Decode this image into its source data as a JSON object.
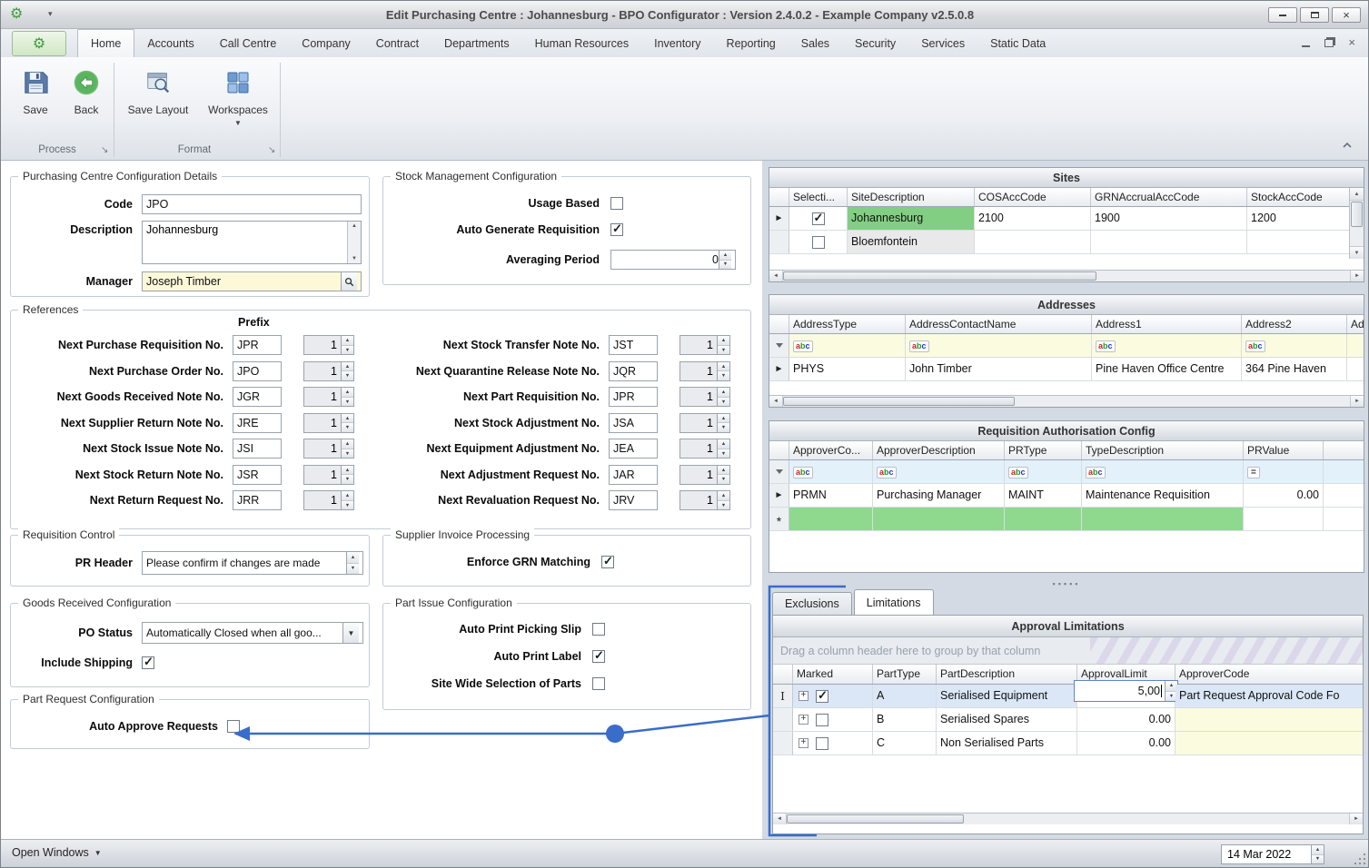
{
  "window": {
    "title": "Edit Purchasing Centre : Johannesburg - BPO Configurator : Version 2.4.0.2 - Example Company v2.5.0.8"
  },
  "ribbon": {
    "tabs": [
      {
        "label": "Home"
      },
      {
        "label": "Accounts"
      },
      {
        "label": "Call Centre"
      },
      {
        "label": "Company"
      },
      {
        "label": "Contract"
      },
      {
        "label": "Departments"
      },
      {
        "label": "Human Resources"
      },
      {
        "label": "Inventory"
      },
      {
        "label": "Reporting"
      },
      {
        "label": "Sales"
      },
      {
        "label": "Security"
      },
      {
        "label": "Services"
      },
      {
        "label": "Static Data"
      }
    ],
    "active_tab": "Home",
    "buttons": {
      "save": "Save",
      "back": "Back",
      "save_layout": "Save Layout",
      "workspaces": "Workspaces"
    },
    "groups": {
      "process": "Process",
      "format": "Format"
    }
  },
  "config_details": {
    "title": "Purchasing Centre Configuration Details",
    "code_label": "Code",
    "code_value": "JPO",
    "description_label": "Description",
    "description_value": "Johannesburg",
    "manager_label": "Manager",
    "manager_value": "Joseph Timber"
  },
  "stock_mgmt": {
    "title": "Stock Management Configuration",
    "usage_based_label": "Usage Based",
    "usage_based": false,
    "auto_generate_label": "Auto Generate Requisition",
    "auto_generate": true,
    "averaging_label": "Averaging Period",
    "averaging_value": "0"
  },
  "references": {
    "title": "References",
    "prefix_label": "Prefix",
    "left": [
      {
        "label": "Next Purchase Requisition No.",
        "prefix": "JPR",
        "value": "1"
      },
      {
        "label": "Next Purchase Order No.",
        "prefix": "JPO",
        "value": "1"
      },
      {
        "label": "Next Goods Received Note No.",
        "prefix": "JGR",
        "value": "1"
      },
      {
        "label": "Next Supplier Return Note No.",
        "prefix": "JRE",
        "value": "1"
      },
      {
        "label": "Next Stock Issue Note No.",
        "prefix": "JSI",
        "value": "1"
      },
      {
        "label": "Next Stock Return Note No.",
        "prefix": "JSR",
        "value": "1"
      },
      {
        "label": "Next Return Request No.",
        "prefix": "JRR",
        "value": "1"
      }
    ],
    "right": [
      {
        "label": "Next Stock Transfer Note No.",
        "prefix": "JST",
        "value": "1"
      },
      {
        "label": "Next Quarantine Release Note No.",
        "prefix": "JQR",
        "value": "1"
      },
      {
        "label": "Next Part Requisition No.",
        "prefix": "JPR",
        "value": "1"
      },
      {
        "label": "Next Stock Adjustment No.",
        "prefix": "JSA",
        "value": "1"
      },
      {
        "label": "Next Equipment Adjustment No.",
        "prefix": "JEA",
        "value": "1"
      },
      {
        "label": "Next Adjustment Request No.",
        "prefix": "JAR",
        "value": "1"
      },
      {
        "label": "Next Revaluation Request No.",
        "prefix": "JRV",
        "value": "1"
      }
    ]
  },
  "requisition_control": {
    "title": "Requisition Control",
    "pr_header_label": "PR Header",
    "pr_header_value": "Please confirm if changes are made"
  },
  "supplier_invoice": {
    "title": "Supplier Invoice Processing",
    "enforce_grn_label": "Enforce GRN Matching",
    "enforce_grn": true
  },
  "goods_received": {
    "title": "Goods Received Configuration",
    "po_status_label": "PO Status",
    "po_status_value": "Automatically Closed when all goo...",
    "include_shipping_label": "Include Shipping",
    "include_shipping": true
  },
  "part_issue": {
    "title": "Part Issue Configuration",
    "auto_print_picking_label": "Auto Print Picking Slip",
    "auto_print_picking": false,
    "auto_print_label_label": "Auto Print Label",
    "auto_print_label": true,
    "site_wide_label": "Site Wide Selection of Parts",
    "site_wide": false
  },
  "part_request": {
    "title": "Part Request Configuration",
    "auto_approve_label": "Auto Approve Requests",
    "auto_approve": false
  },
  "sites": {
    "title": "Sites",
    "columns": [
      "Selecti...",
      "SiteDescription",
      "COSAccCode",
      "GRNAccrualAccCode",
      "StockAccCode"
    ],
    "rows": [
      {
        "selected": true,
        "site": "Johannesburg",
        "cos": "2100",
        "grn": "1900",
        "stock": "1200"
      },
      {
        "selected": false,
        "site": "Bloemfontein",
        "cos": "",
        "grn": "",
        "stock": ""
      }
    ]
  },
  "addresses": {
    "title": "Addresses",
    "columns": [
      "AddressType",
      "AddressContactName",
      "Address1",
      "Address2",
      "Ad"
    ],
    "rows": [
      {
        "type": "PHYS",
        "contact": "John Timber",
        "address1": "Pine Haven Office Centre",
        "address2": "364 Pine Haven"
      }
    ]
  },
  "req_auth": {
    "title": "Requisition Authorisation Config",
    "columns": [
      "ApproverCo...",
      "ApproverDescription",
      "PRType",
      "TypeDescription",
      "PRValue"
    ],
    "filter_equals": "=",
    "rows": [
      {
        "code": "PRMN",
        "desc": "Purchasing Manager",
        "type": "MAINT",
        "typedesc": "Maintenance Requisition",
        "value": "0.00"
      }
    ]
  },
  "limit_tabs": {
    "exclusions": "Exclusions",
    "limitations": "Limitations",
    "active": "Limitations"
  },
  "approval_limitations": {
    "title": "Approval Limitations",
    "group_hint": "Drag a column header here to group by that column",
    "columns": [
      "Marked",
      "PartType",
      "PartDescription",
      "ApprovalLimit",
      "ApproverCode"
    ],
    "rows": [
      {
        "marked": true,
        "parttype": "A",
        "partdesc": "Serialised Equipment",
        "limit": "5,00",
        "approver": "Part Request Approval Code Fo"
      },
      {
        "marked": false,
        "parttype": "B",
        "partdesc": "Serialised Spares",
        "limit": "0.00",
        "approver": ""
      },
      {
        "marked": false,
        "parttype": "C",
        "partdesc": "Non Serialised Parts",
        "limit": "0.00",
        "approver": ""
      }
    ]
  },
  "statusbar": {
    "open_windows": "Open Windows",
    "date": "14 Mar 2022"
  },
  "icons": {
    "gear-icon": "⚙",
    "chevron-down-icon": "▾",
    "minimize-icon": "minus-bar",
    "maximize-icon": "box",
    "close-icon": "×",
    "save-icon": "floppy-disk",
    "back-icon": "green-circle-left-arrow",
    "save-layout-icon": "window-with-magnifier",
    "workspaces-icon": "blue-grid",
    "search-icon": "magnifier",
    "row-current-icon": "►",
    "row-new-icon": "*",
    "row-edit-icon": "I",
    "filter-icon": "funnel",
    "abc-filter-icon": "abc",
    "up-arrow-icon": "▲",
    "down-arrow-icon": "▼",
    "left-arrow-icon": "◄",
    "right-arrow-icon": "►",
    "expand-icon": "+",
    "check-icon": "✓"
  },
  "annotation": {
    "color": "#3a6cc9"
  }
}
